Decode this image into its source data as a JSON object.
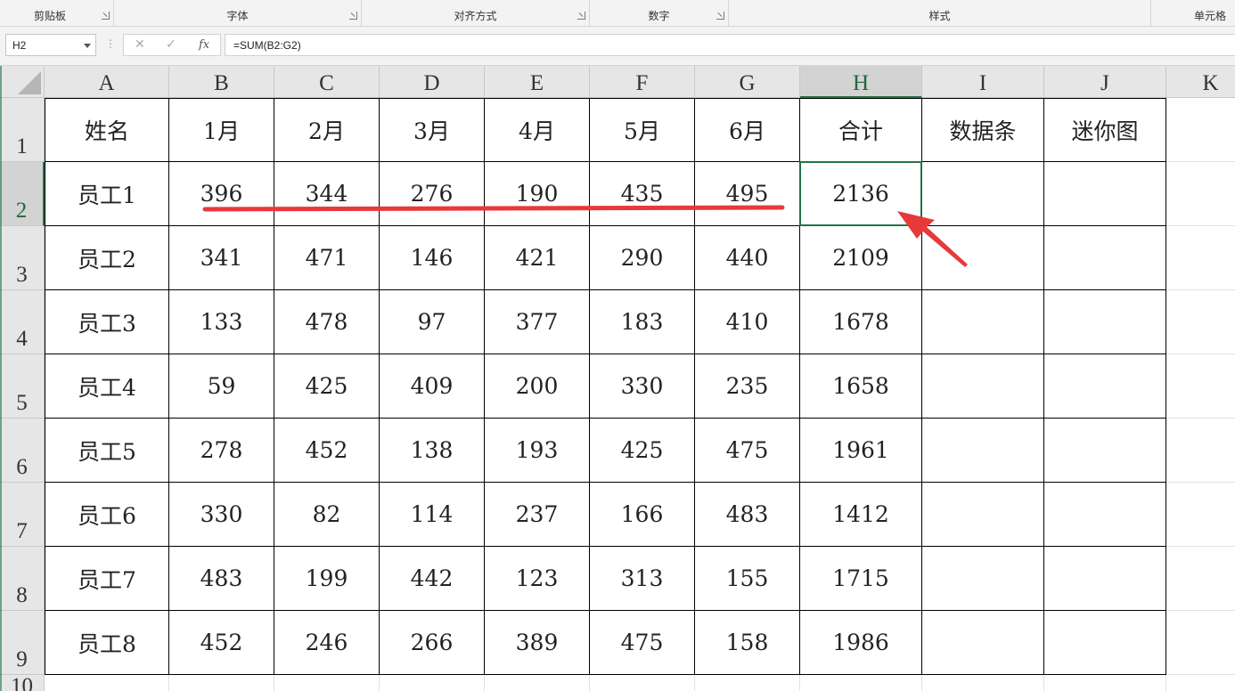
{
  "ribbon": {
    "groups": [
      {
        "label": "剪贴板",
        "has_launcher": true
      },
      {
        "label": "字体",
        "has_launcher": true
      },
      {
        "label": "对齐方式",
        "has_launcher": true
      },
      {
        "label": "数字",
        "has_launcher": true
      },
      {
        "label": "样式",
        "has_launcher": false
      },
      {
        "label": "单元格",
        "has_launcher": false
      }
    ]
  },
  "formula_bar": {
    "name_box": "H2",
    "cancel_icon": "close-icon",
    "enter_icon": "check-icon",
    "fx_label": "fx",
    "formula": "=SUM(B2:G2)"
  },
  "grid": {
    "columns": [
      "A",
      "B",
      "C",
      "D",
      "E",
      "F",
      "G",
      "H",
      "I",
      "J",
      "K"
    ],
    "row_numbers": [
      "1",
      "2",
      "3",
      "4",
      "5",
      "6",
      "7",
      "8",
      "9",
      "10"
    ],
    "selected_cell": "H2",
    "rows": [
      [
        "姓名",
        "1月",
        "2月",
        "3月",
        "4月",
        "5月",
        "6月",
        "合计",
        "数据条",
        "迷你图"
      ],
      [
        "员工1",
        "396",
        "344",
        "276",
        "190",
        "435",
        "495",
        "2136",
        "",
        ""
      ],
      [
        "员工2",
        "341",
        "471",
        "146",
        "421",
        "290",
        "440",
        "2109",
        "",
        ""
      ],
      [
        "员工3",
        "133",
        "478",
        "97",
        "377",
        "183",
        "410",
        "1678",
        "",
        ""
      ],
      [
        "员工4",
        "59",
        "425",
        "409",
        "200",
        "330",
        "235",
        "1658",
        "",
        ""
      ],
      [
        "员工5",
        "278",
        "452",
        "138",
        "193",
        "425",
        "475",
        "1961",
        "",
        ""
      ],
      [
        "员工6",
        "330",
        "82",
        "114",
        "237",
        "166",
        "483",
        "1412",
        "",
        ""
      ],
      [
        "员工7",
        "483",
        "199",
        "442",
        "123",
        "313",
        "155",
        "1715",
        "",
        ""
      ],
      [
        "员工8",
        "452",
        "246",
        "266",
        "389",
        "475",
        "158",
        "1986",
        "",
        ""
      ]
    ]
  },
  "annotation": {
    "color": "#e8393a"
  },
  "colors": {
    "accent": "#217346",
    "annotation": "#e8393a"
  }
}
